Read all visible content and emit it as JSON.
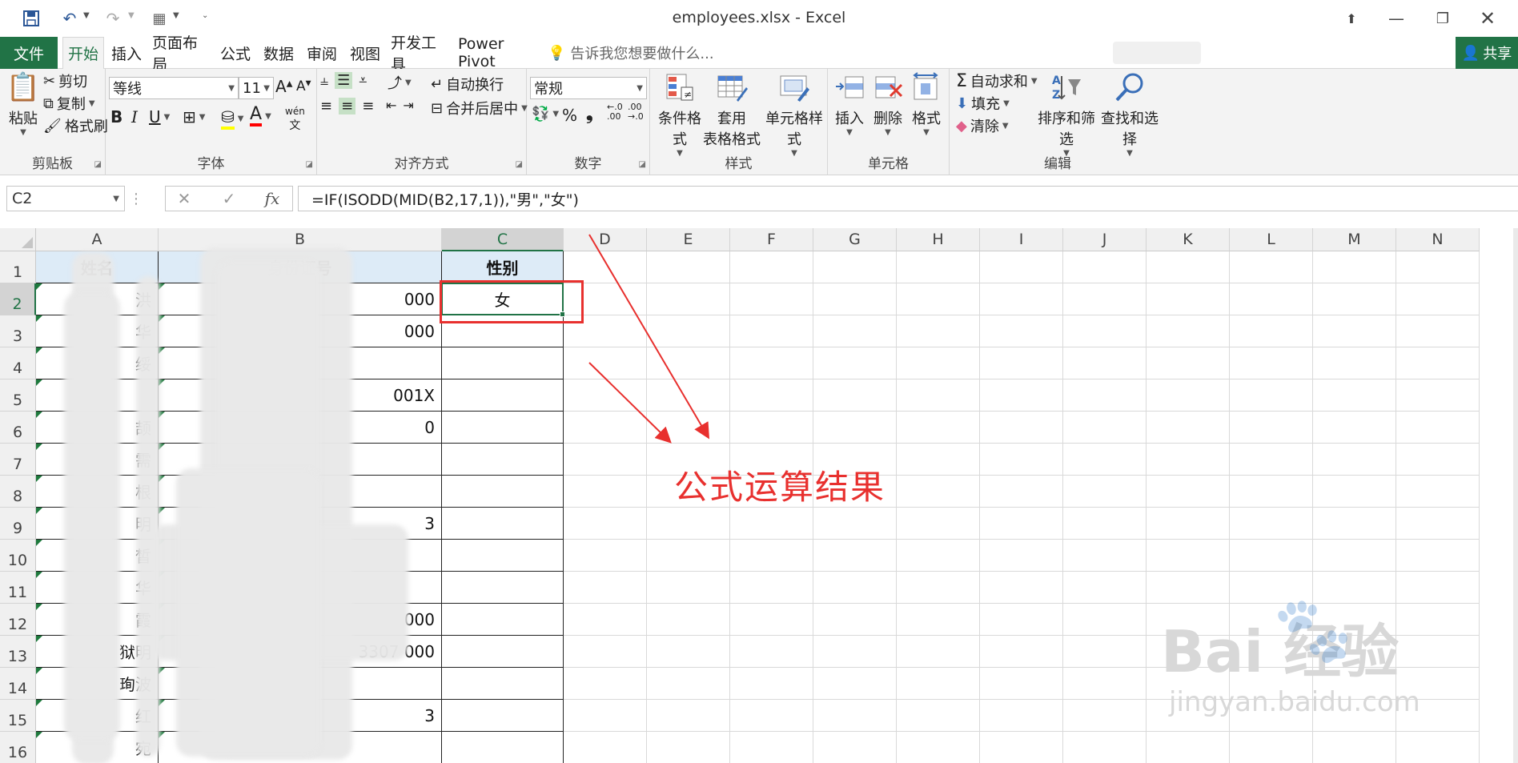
{
  "window": {
    "title": "employees.xlsx - Excel"
  },
  "tabs": [
    {
      "label": "文件"
    },
    {
      "label": "开始"
    },
    {
      "label": "插入"
    },
    {
      "label": "页面布局"
    },
    {
      "label": "公式"
    },
    {
      "label": "数据"
    },
    {
      "label": "审阅"
    },
    {
      "label": "视图"
    },
    {
      "label": "开发工具"
    },
    {
      "label": "Power Pivot"
    }
  ],
  "tell_me": "告诉我您想要做什么...",
  "share": "共享",
  "ribbon": {
    "clipboard": {
      "label": "剪贴板",
      "paste": "粘贴",
      "cut": "剪切",
      "copy": "复制",
      "format_painter": "格式刷"
    },
    "font": {
      "label": "字体",
      "name": "等线",
      "size": "11",
      "phonetic": "wén"
    },
    "alignment": {
      "label": "对齐方式",
      "wrap": "自动换行",
      "merge": "合并后居中"
    },
    "number": {
      "label": "数字",
      "format": "常规",
      "percent": "%",
      "comma": "❟",
      "inc_decimal": "←.0\n.00",
      "dec_decimal": ".00\n→.0"
    },
    "styles": {
      "label": "样式",
      "conditional": "条件格式",
      "table_line1": "套用",
      "table_line2": "表格格式",
      "cell_styles": "单元格样式"
    },
    "cells": {
      "label": "单元格",
      "insert": "插入",
      "delete": "删除",
      "format": "格式"
    },
    "editing": {
      "label": "编辑",
      "autosum": "自动求和",
      "fill": "填充",
      "clear": "清除",
      "sort": "排序和筛选",
      "find": "查找和选择"
    }
  },
  "formula_bar": {
    "name_box": "C2",
    "formula": "=IF(ISODD(MID(B2,17,1)),\"男\",\"女\")"
  },
  "sheet": {
    "columns": [
      "A",
      "B",
      "C",
      "D",
      "E",
      "F",
      "G",
      "H",
      "I",
      "J",
      "K",
      "L",
      "M",
      "N"
    ],
    "rows": [
      "1",
      "2",
      "3",
      "4",
      "5",
      "6",
      "7",
      "8",
      "9",
      "10",
      "11",
      "12",
      "13",
      "14",
      "15",
      "16"
    ],
    "header": {
      "a": "姓名",
      "b": "身份证号",
      "c": "性别"
    },
    "data": [
      {
        "a": "洪",
        "b": "000",
        "c": "女"
      },
      {
        "a": "华",
        "b": "000",
        "c": ""
      },
      {
        "a": "绥",
        "b": "",
        "c": ""
      },
      {
        "a": "",
        "b": "001X",
        "c": ""
      },
      {
        "a": "颉",
        "b": "0",
        "c": ""
      },
      {
        "a": "需",
        "b": "",
        "c": ""
      },
      {
        "a": "根",
        "b": "",
        "c": ""
      },
      {
        "a": "明",
        "b": "3",
        "c": ""
      },
      {
        "a": "皙",
        "b": "",
        "c": ""
      },
      {
        "a": "华",
        "b": "",
        "c": ""
      },
      {
        "a": "霞",
        "b": "000",
        "c": ""
      },
      {
        "a": "狱明",
        "b": "3307 000",
        "c": ""
      },
      {
        "a": "珣波",
        "b": "",
        "c": ""
      },
      {
        "a": "红",
        "b": "3",
        "c": ""
      },
      {
        "a": "宛",
        "b": "",
        "c": ""
      }
    ]
  },
  "annotation": "公式运算结果",
  "watermark": {
    "brand": "Bai  经验",
    "url": "jingyan.baidu.com"
  },
  "colors": {
    "excel_green": "#217346",
    "header_fill": "#ddebf7",
    "annotation_red": "#e8302e"
  }
}
